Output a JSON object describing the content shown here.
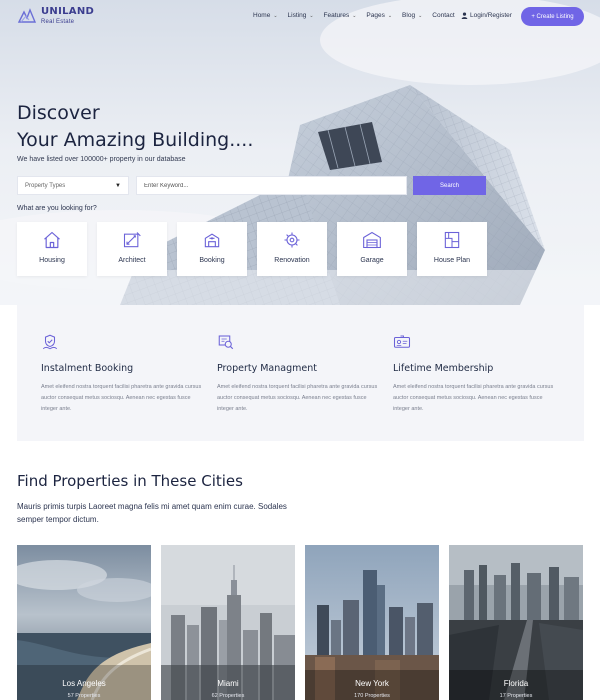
{
  "brand": {
    "name": "UNILAND",
    "tagline": "Real Estate",
    "accent": "#7065e6"
  },
  "nav": {
    "items": [
      {
        "label": "Home",
        "dropdown": true
      },
      {
        "label": "Listing",
        "dropdown": true
      },
      {
        "label": "Features",
        "dropdown": true
      },
      {
        "label": "Pages",
        "dropdown": true
      },
      {
        "label": "Blog",
        "dropdown": true
      },
      {
        "label": "Contact",
        "dropdown": false
      }
    ],
    "login": "Login/Register",
    "create_listing": "+ Create Listing"
  },
  "hero": {
    "title_line1": "Discover",
    "title_line2": "Your Amazing Building....",
    "subtitle": "We have listed over 100000+ property in our database",
    "search": {
      "type_select": "Property Types",
      "keyword_placeholder": "Enter Keyword...",
      "button": "Search"
    },
    "looking_label": "What are you looking for?",
    "categories": [
      {
        "label": "Housing",
        "icon": "house-icon"
      },
      {
        "label": "Architect",
        "icon": "drafting-icon"
      },
      {
        "label": "Booking",
        "icon": "booking-icon"
      },
      {
        "label": "Renovation",
        "icon": "renovation-icon"
      },
      {
        "label": "Garage",
        "icon": "garage-icon"
      },
      {
        "label": "House Plan",
        "icon": "house-plan-icon"
      }
    ]
  },
  "features": [
    {
      "title": "Instalment Booking",
      "icon": "hand-shield-icon",
      "desc": "Amet eleifend nostra torquent facilisi pharetra ante gravida cursus auctor consequat metus sociosqu. Aenean nec egestas fusce integer ante."
    },
    {
      "title": "Property Managment",
      "icon": "property-search-icon",
      "desc": "Amet eleifend nostra torquent facilisi pharetra ante gravida cursus auctor consequat metus sociosqu. Aenean nec egestas fusce integer ante."
    },
    {
      "title": "Lifetime Membership",
      "icon": "id-card-icon",
      "desc": "Amet eleifend nostra torquent facilisi pharetra ante gravida cursus auctor consequat metus sociosqu. Aenean nec egestas fusce integer ante."
    }
  ],
  "cities": {
    "title": "Find Properties in These Cities",
    "desc": "Mauris primis turpis Laoreet magna felis mi amet quam enim curae. Sodales semper tempor dictum.",
    "items": [
      {
        "name": "Los Angeles",
        "count": "57 Properties"
      },
      {
        "name": "Miami",
        "count": "62 Properties"
      },
      {
        "name": "New York",
        "count": "170 Properties"
      },
      {
        "name": "Florida",
        "count": "17 Properties"
      }
    ]
  }
}
